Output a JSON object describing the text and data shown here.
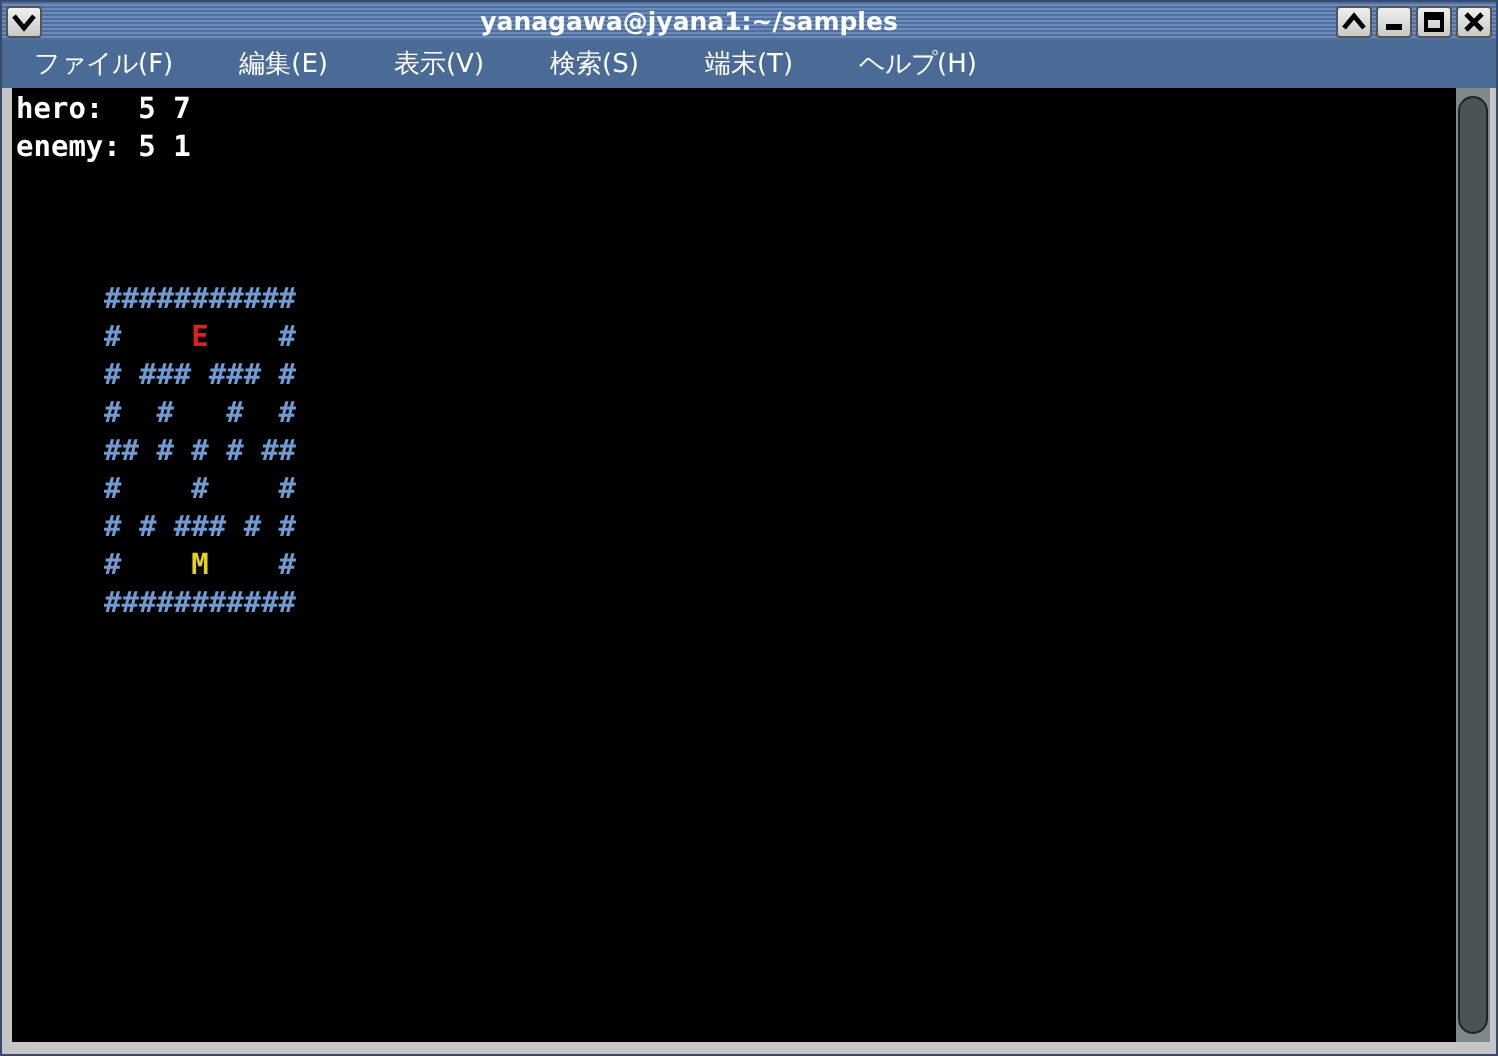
{
  "window": {
    "title": "yanagawa@jyana1:~/samples"
  },
  "menu": [
    "ファイル(F)",
    "編集(E)",
    "表示(V)",
    "検索(S)",
    "端末(T)",
    "ヘルプ(H)"
  ],
  "status_lines": [
    "hero:  5 7",
    "enemy: 5 1"
  ],
  "maze_rows": [
    [
      {
        "text": "###########",
        "kind": "wall"
      }
    ],
    [
      {
        "text": "#    ",
        "kind": "wall"
      },
      {
        "text": "E",
        "kind": "enemy"
      },
      {
        "text": "    #",
        "kind": "wall"
      }
    ],
    [
      {
        "text": "# ### ### #",
        "kind": "wall"
      }
    ],
    [
      {
        "text": "#  #   #  #",
        "kind": "wall"
      }
    ],
    [
      {
        "text": "## # # # ##",
        "kind": "wall"
      }
    ],
    [
      {
        "text": "#    #    #",
        "kind": "wall"
      }
    ],
    [
      {
        "text": "# # ### # #",
        "kind": "wall"
      }
    ],
    [
      {
        "text": "#    ",
        "kind": "wall"
      },
      {
        "text": "M",
        "kind": "hero"
      },
      {
        "text": "    #",
        "kind": "wall"
      }
    ],
    [
      {
        "text": "###########",
        "kind": "wall"
      }
    ]
  ]
}
